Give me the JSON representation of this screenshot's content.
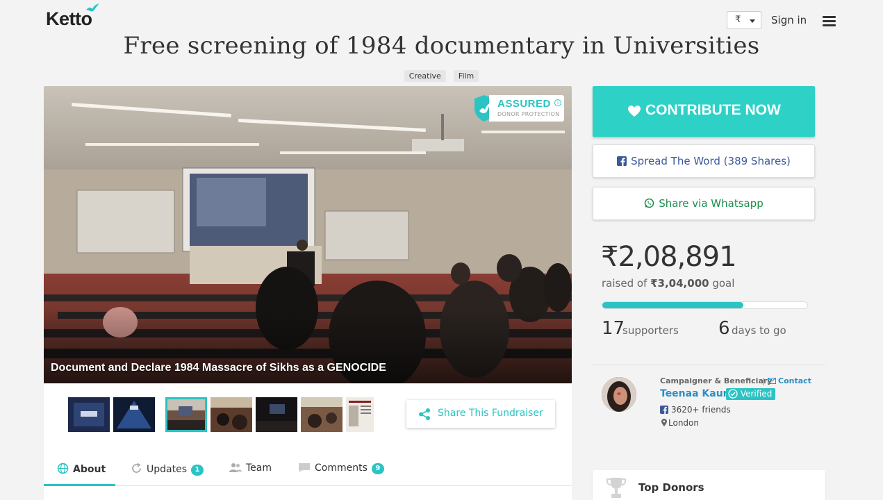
{
  "header": {
    "logo_text": "Ketto",
    "currency": "₹",
    "signin_label": "Sign in"
  },
  "campaign": {
    "title": "Free screening of 1984 documentary in Universities",
    "tags": [
      "Creative",
      "Film"
    ],
    "hero_caption": "Document and Declare 1984 Massacre of Sikhs as a GENOCIDE",
    "assured_label": "ASSURED",
    "assured_sub": "DONOR PROTECTION"
  },
  "actions": {
    "contribute_label": "CONTRIBUTE NOW",
    "spread_label": "Spread The Word (389 Shares)",
    "whatsapp_label": "Share via Whatsapp",
    "share_fundraiser_label": "Share This Fundraiser"
  },
  "funding": {
    "raised": "₹2,08,891",
    "raised_prefix": "raised of",
    "goal": "₹3,04,000",
    "goal_suffix": "goal",
    "progress_fraction": 0.687,
    "supporters_count": "17",
    "supporters_label": "supporters",
    "days_count": "6",
    "days_label": "days to go"
  },
  "campaigner": {
    "role": "Campaigner & Beneficiary",
    "contact_label": "Contact",
    "name": "Teenaa Kaur",
    "verified_label": "Verified",
    "friends": "3620+ friends",
    "location": "London"
  },
  "tabs": [
    {
      "label": "About"
    },
    {
      "label": "Updates",
      "count": "1"
    },
    {
      "label": "Team"
    },
    {
      "label": "Comments",
      "count": "9"
    }
  ],
  "top_donors_title": "Top Donors",
  "colors": {
    "accent": "#2bc3c3",
    "contribute_bg": "#2ed1c6",
    "facebook": "#3b5998",
    "whatsapp": "#1a8d4c",
    "link": "#2b8fc4"
  },
  "icons": [
    "ketto-bird-icon",
    "menu-icon",
    "shield-icon",
    "info-icon",
    "heart-icon",
    "facebook-icon",
    "whatsapp-icon",
    "share-icon",
    "globe-icon",
    "refresh-icon",
    "team-icon",
    "comment-icon",
    "envelope-icon",
    "check-icon",
    "location-pin-icon",
    "trophy-icon"
  ]
}
